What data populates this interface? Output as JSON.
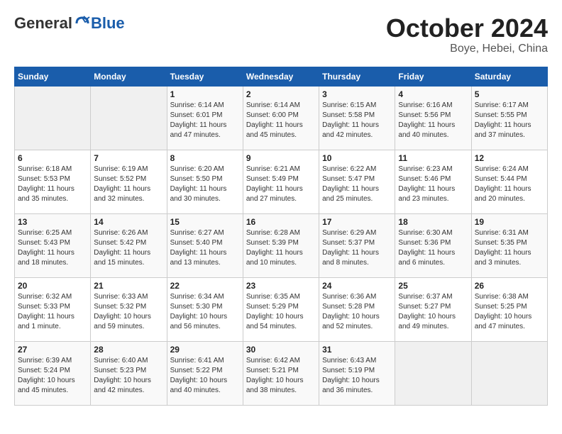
{
  "logo": {
    "general": "General",
    "blue": "Blue"
  },
  "title": {
    "month": "October 2024",
    "location": "Boye, Hebei, China"
  },
  "weekdays": [
    "Sunday",
    "Monday",
    "Tuesday",
    "Wednesday",
    "Thursday",
    "Friday",
    "Saturday"
  ],
  "weeks": [
    [
      {
        "day": "",
        "empty": true
      },
      {
        "day": "",
        "empty": true
      },
      {
        "day": "1",
        "sunrise": "6:14 AM",
        "sunset": "6:01 PM",
        "daylight": "11 hours and 47 minutes."
      },
      {
        "day": "2",
        "sunrise": "6:14 AM",
        "sunset": "6:00 PM",
        "daylight": "11 hours and 45 minutes."
      },
      {
        "day": "3",
        "sunrise": "6:15 AM",
        "sunset": "5:58 PM",
        "daylight": "11 hours and 42 minutes."
      },
      {
        "day": "4",
        "sunrise": "6:16 AM",
        "sunset": "5:56 PM",
        "daylight": "11 hours and 40 minutes."
      },
      {
        "day": "5",
        "sunrise": "6:17 AM",
        "sunset": "5:55 PM",
        "daylight": "11 hours and 37 minutes."
      }
    ],
    [
      {
        "day": "6",
        "sunrise": "6:18 AM",
        "sunset": "5:53 PM",
        "daylight": "11 hours and 35 minutes."
      },
      {
        "day": "7",
        "sunrise": "6:19 AM",
        "sunset": "5:52 PM",
        "daylight": "11 hours and 32 minutes."
      },
      {
        "day": "8",
        "sunrise": "6:20 AM",
        "sunset": "5:50 PM",
        "daylight": "11 hours and 30 minutes."
      },
      {
        "day": "9",
        "sunrise": "6:21 AM",
        "sunset": "5:49 PM",
        "daylight": "11 hours and 27 minutes."
      },
      {
        "day": "10",
        "sunrise": "6:22 AM",
        "sunset": "5:47 PM",
        "daylight": "11 hours and 25 minutes."
      },
      {
        "day": "11",
        "sunrise": "6:23 AM",
        "sunset": "5:46 PM",
        "daylight": "11 hours and 23 minutes."
      },
      {
        "day": "12",
        "sunrise": "6:24 AM",
        "sunset": "5:44 PM",
        "daylight": "11 hours and 20 minutes."
      }
    ],
    [
      {
        "day": "13",
        "sunrise": "6:25 AM",
        "sunset": "5:43 PM",
        "daylight": "11 hours and 18 minutes."
      },
      {
        "day": "14",
        "sunrise": "6:26 AM",
        "sunset": "5:42 PM",
        "daylight": "11 hours and 15 minutes."
      },
      {
        "day": "15",
        "sunrise": "6:27 AM",
        "sunset": "5:40 PM",
        "daylight": "11 hours and 13 minutes."
      },
      {
        "day": "16",
        "sunrise": "6:28 AM",
        "sunset": "5:39 PM",
        "daylight": "11 hours and 10 minutes."
      },
      {
        "day": "17",
        "sunrise": "6:29 AM",
        "sunset": "5:37 PM",
        "daylight": "11 hours and 8 minutes."
      },
      {
        "day": "18",
        "sunrise": "6:30 AM",
        "sunset": "5:36 PM",
        "daylight": "11 hours and 6 minutes."
      },
      {
        "day": "19",
        "sunrise": "6:31 AM",
        "sunset": "5:35 PM",
        "daylight": "11 hours and 3 minutes."
      }
    ],
    [
      {
        "day": "20",
        "sunrise": "6:32 AM",
        "sunset": "5:33 PM",
        "daylight": "11 hours and 1 minute."
      },
      {
        "day": "21",
        "sunrise": "6:33 AM",
        "sunset": "5:32 PM",
        "daylight": "10 hours and 59 minutes."
      },
      {
        "day": "22",
        "sunrise": "6:34 AM",
        "sunset": "5:30 PM",
        "daylight": "10 hours and 56 minutes."
      },
      {
        "day": "23",
        "sunrise": "6:35 AM",
        "sunset": "5:29 PM",
        "daylight": "10 hours and 54 minutes."
      },
      {
        "day": "24",
        "sunrise": "6:36 AM",
        "sunset": "5:28 PM",
        "daylight": "10 hours and 52 minutes."
      },
      {
        "day": "25",
        "sunrise": "6:37 AM",
        "sunset": "5:27 PM",
        "daylight": "10 hours and 49 minutes."
      },
      {
        "day": "26",
        "sunrise": "6:38 AM",
        "sunset": "5:25 PM",
        "daylight": "10 hours and 47 minutes."
      }
    ],
    [
      {
        "day": "27",
        "sunrise": "6:39 AM",
        "sunset": "5:24 PM",
        "daylight": "10 hours and 45 minutes."
      },
      {
        "day": "28",
        "sunrise": "6:40 AM",
        "sunset": "5:23 PM",
        "daylight": "10 hours and 42 minutes."
      },
      {
        "day": "29",
        "sunrise": "6:41 AM",
        "sunset": "5:22 PM",
        "daylight": "10 hours and 40 minutes."
      },
      {
        "day": "30",
        "sunrise": "6:42 AM",
        "sunset": "5:21 PM",
        "daylight": "10 hours and 38 minutes."
      },
      {
        "day": "31",
        "sunrise": "6:43 AM",
        "sunset": "5:19 PM",
        "daylight": "10 hours and 36 minutes."
      },
      {
        "day": "",
        "empty": true
      },
      {
        "day": "",
        "empty": true
      }
    ]
  ],
  "labels": {
    "sunrise": "Sunrise:",
    "sunset": "Sunset:",
    "daylight": "Daylight:"
  }
}
